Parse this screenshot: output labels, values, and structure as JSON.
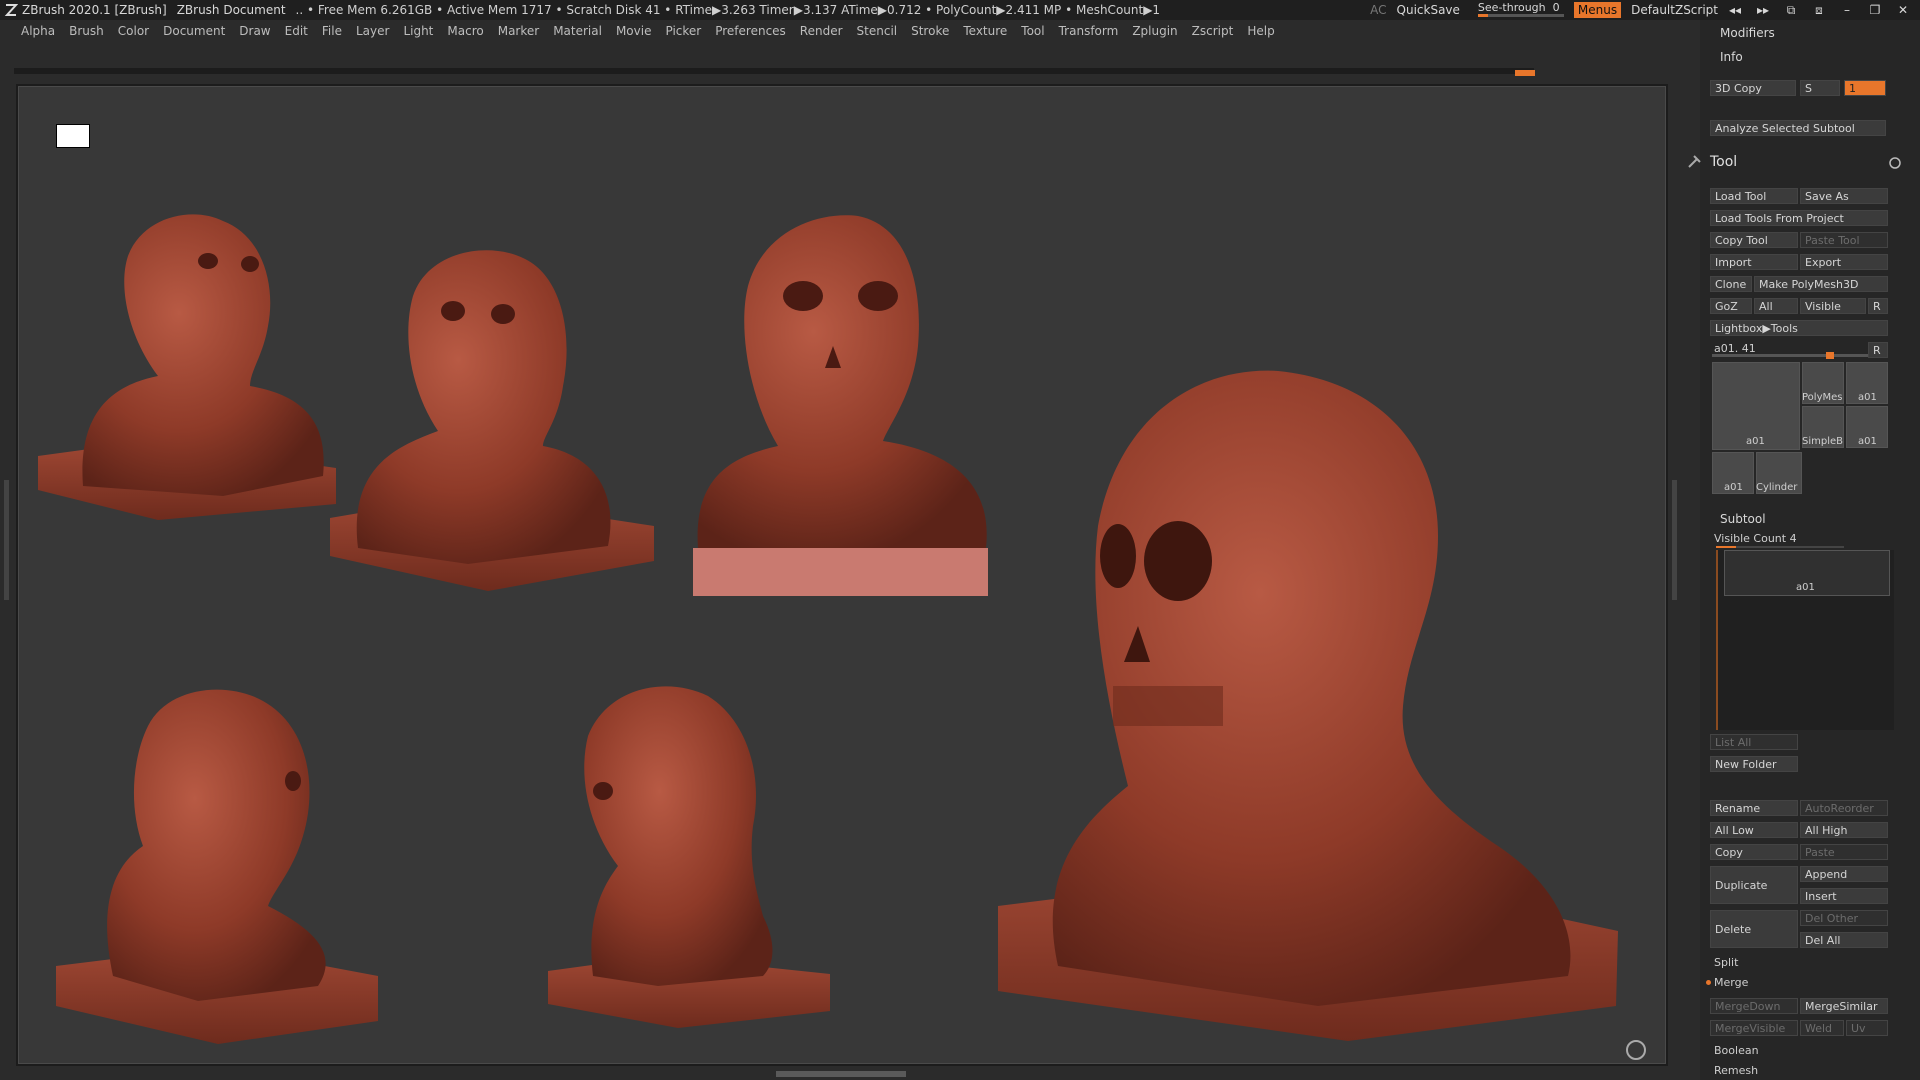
{
  "titlebar": {
    "app": "ZBrush 2020.1 [ZBrush]",
    "document": "ZBrush Document",
    "stats": ".. • Free Mem 6.261GB • Active Mem 1717 • Scratch Disk 41 •  RTime▶3.263 Timer▶3.137 ATime▶0.712 • PolyCount▶2.411 MP  • MeshCount▶1",
    "ac": "AC",
    "quicksave": "QuickSave",
    "see_through_label": "See-through",
    "see_through_value": "0",
    "menus": "Menus",
    "script": "DefaultZScript",
    "accent": "#e8762b"
  },
  "menubar": [
    "Alpha",
    "Brush",
    "Color",
    "Document",
    "Draw",
    "Edit",
    "File",
    "Layer",
    "Light",
    "Macro",
    "Marker",
    "Material",
    "Movie",
    "Picker",
    "Preferences",
    "Render",
    "Stencil",
    "Stroke",
    "Texture",
    "Tool",
    "Transform",
    "Zplugin",
    "Zscript",
    "Help"
  ],
  "panel": {
    "modifiers": "Modifiers",
    "info": "Info",
    "copy3d": "3D Copy",
    "s_label": "S",
    "s_value": "1",
    "analyze": "Analyze Selected Subtool",
    "tool_title": "Tool",
    "load_tool": "Load Tool",
    "save_as": "Save As",
    "load_from_project": "Load Tools From Project",
    "copy_tool": "Copy Tool",
    "paste_tool": "Paste Tool",
    "import": "Import",
    "export": "Export",
    "clone": "Clone",
    "make_polymesh": "Make PolyMesh3D",
    "goz": "GoZ",
    "all": "All",
    "visible": "Visible",
    "r": "R",
    "lightbox_tools": "Lightbox▶Tools",
    "current_tool": "a01. 41",
    "thumbs": {
      "a01_main": "a01",
      "polymesh": "PolyMes",
      "a01_small": "a01",
      "simpleb": "SimpleB",
      "a01_b": "a01",
      "a01_c": "a01",
      "cylinder": "Cylinder"
    },
    "subtool": "Subtool",
    "visible_count": "Visible Count 4",
    "subtool_item": "a01",
    "list_all": "List All",
    "new_folder": "New Folder",
    "rename": "Rename",
    "autoreorder": "AutoReorder",
    "all_low": "All Low",
    "all_high": "All High",
    "copy": "Copy",
    "paste": "Paste",
    "duplicate": "Duplicate",
    "append": "Append",
    "insert": "Insert",
    "delete": "Delete",
    "del_other": "Del Other",
    "del_all": "Del All",
    "split": "Split",
    "merge": "Merge",
    "mergedown": "MergeDown",
    "mergesimilar": "MergeSimilar",
    "mergevisible": "MergeVisible",
    "weld": "Weld",
    "uv": "Uv",
    "boolean": "Boolean",
    "remesh": "Remesh"
  }
}
